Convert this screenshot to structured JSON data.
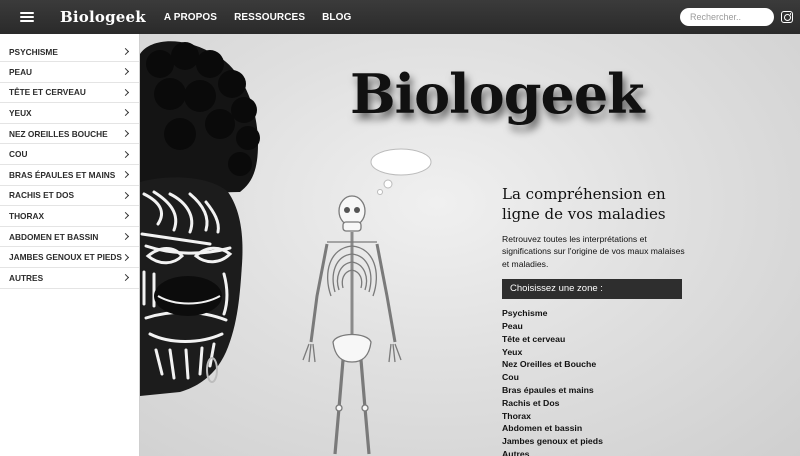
{
  "header": {
    "logo": "Biologeek",
    "nav": [
      "A PROPOS",
      "RESSOURCES",
      "BLOG"
    ],
    "search_placeholder": "Rechercher..",
    "icons": [
      "menu-icon",
      "instagram-icon"
    ]
  },
  "sidebar": {
    "items": [
      {
        "label": "PSYCHISME"
      },
      {
        "label": "PEAU"
      },
      {
        "label": "TÊTE ET CERVEAU"
      },
      {
        "label": "YEUX"
      },
      {
        "label": "NEZ OREILLES BOUCHE"
      },
      {
        "label": "COU"
      },
      {
        "label": "BRAS ÉPAULES ET MAINS"
      },
      {
        "label": "RACHIS ET DOS"
      },
      {
        "label": "THORAX"
      },
      {
        "label": "ABDOMEN ET BASSIN"
      },
      {
        "label": "JAMBES GENOUX ET PIEDS"
      },
      {
        "label": "AUTRES"
      }
    ]
  },
  "hero": {
    "title": "Biologeek",
    "tagline": "La compréhension en ligne de vos maladies",
    "intro": "Retrouvez toutes les interprétations et significations sur l'origine de vos maux malaises et maladies.",
    "zone_title": "Choisissez une zone :",
    "zones": [
      "Psychisme",
      "Peau",
      "Tête et cerveau",
      "Yeux",
      "Nez Oreilles et Bouche",
      "Cou",
      "Bras épaules et mains",
      "Rachis et Dos",
      "Thorax",
      "Abdomen et bassin",
      "Jambes genoux et pieds",
      "Autres"
    ]
  },
  "colors": {
    "topbar": "#2f2f2f",
    "sidebar": "#ffffff",
    "zone_box": "#2e2e2e",
    "hero_bg": "#e0e0e0"
  }
}
